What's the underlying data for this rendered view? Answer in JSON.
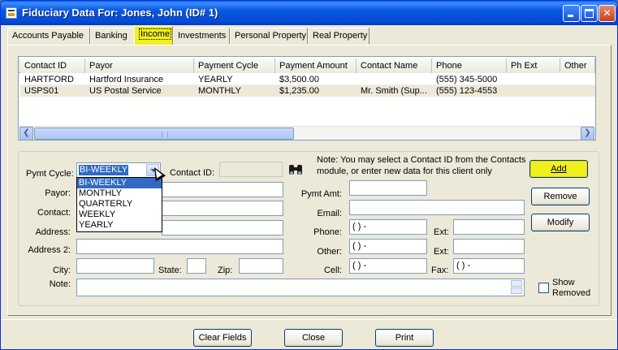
{
  "window": {
    "title": "Fiduciary Data For:  Jones, John (ID# 1)"
  },
  "tabs": [
    "Accounts Payable",
    "Banking",
    "Income",
    "Investments",
    "Personal Property",
    "Real Property"
  ],
  "grid": {
    "columns": [
      "Contact ID",
      "Payor",
      "Payment Cycle",
      "Payment Amount",
      "Contact Name",
      "Phone",
      "Ph Ext",
      "Other"
    ],
    "rows": [
      [
        "HARTFORD",
        "Hartford Insurance",
        "YEARLY",
        "$3,500.00",
        "",
        "(555) 345-5000",
        "",
        ""
      ],
      [
        "USPS01",
        "US Postal Service",
        "MONTHLY",
        "$1,235.00",
        "Mr. Smith (Sup...",
        "(555) 123-4553",
        "",
        ""
      ]
    ]
  },
  "form": {
    "pymt_cycle_label": "Pymt Cycle:",
    "pymt_cycle_value": "BI-WEEKLY",
    "pymt_cycle_options": [
      "BI-WEEKLY",
      "MONTHLY",
      "QUARTERLY",
      "WEEKLY",
      "YEARLY"
    ],
    "contact_id_label": "Contact ID:",
    "note_text_1": "Note: You may select a Contact ID from the Contacts",
    "note_text_2": "module, or enter new data for this client only",
    "payor_label": "Payor:",
    "contact_label": "Contact:",
    "address_label": "Address:",
    "address2_label": "Address 2:",
    "city_label": "City:",
    "state_label": "State:",
    "zip_label": "Zip:",
    "note_label": "Note:",
    "pymt_amt_label": "Pymt Amt:",
    "email_label": "Email:",
    "phone_label": "Phone:",
    "other_label": "Other:",
    "cell_label": "Cell:",
    "ext_label": "Ext:",
    "ext2_label": "Ext:",
    "fax_label": "Fax:",
    "phone_mask": "(  )   -",
    "show_removed_1": "Show",
    "show_removed_2": "Removed"
  },
  "buttons": {
    "add": "Add",
    "remove": "Remove",
    "modify": "Modify",
    "clear_fields": "Clear Fields",
    "close": "Close",
    "print": "Print"
  },
  "colors": {
    "highlight": "#f0f020",
    "selection": "#316ac5",
    "titlebar": "#0858e0"
  }
}
